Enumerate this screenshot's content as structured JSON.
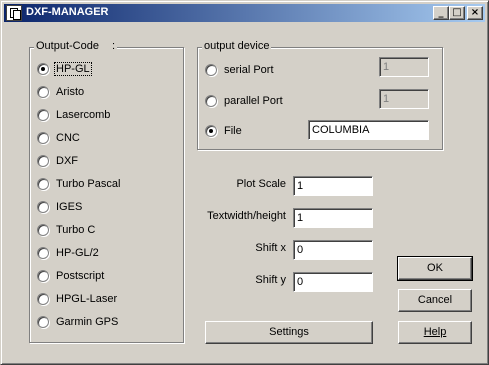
{
  "window": {
    "title": "DXF-MANAGER",
    "controls": {
      "minimize": "_",
      "maximize": "□",
      "close": "×"
    }
  },
  "output_code": {
    "label": "Output-Code",
    "label_suffix": ":",
    "selected": "HP-GL",
    "options": [
      "HP-GL",
      "Aristo",
      "Lasercomb",
      "CNC",
      "DXF",
      "Turbo Pascal",
      "IGES",
      "Turbo C",
      "HP-GL/2",
      "Postscript",
      "HPGL-Laser",
      "Garmin GPS"
    ]
  },
  "output_device": {
    "label": "output device",
    "serial": {
      "label": "serial Port",
      "value": "1"
    },
    "parallel": {
      "label": "parallel Port",
      "value": "1"
    },
    "file": {
      "label": "File",
      "value": "COLUMBIA"
    },
    "selected": "File"
  },
  "params": {
    "plot_scale": {
      "label": "Plot Scale",
      "value": "1"
    },
    "textwidth": {
      "label": "Textwidth/height",
      "value": "1"
    },
    "shift_x": {
      "label": "Shift x",
      "value": "0"
    },
    "shift_y": {
      "label": "Shift y",
      "value": "0"
    }
  },
  "buttons": {
    "ok": "OK",
    "cancel": "Cancel",
    "help": "Help",
    "settings": "Settings"
  },
  "colors": {
    "face": "#d4d0c8",
    "title_start": "#0a246a",
    "title_end": "#a6caf0"
  }
}
